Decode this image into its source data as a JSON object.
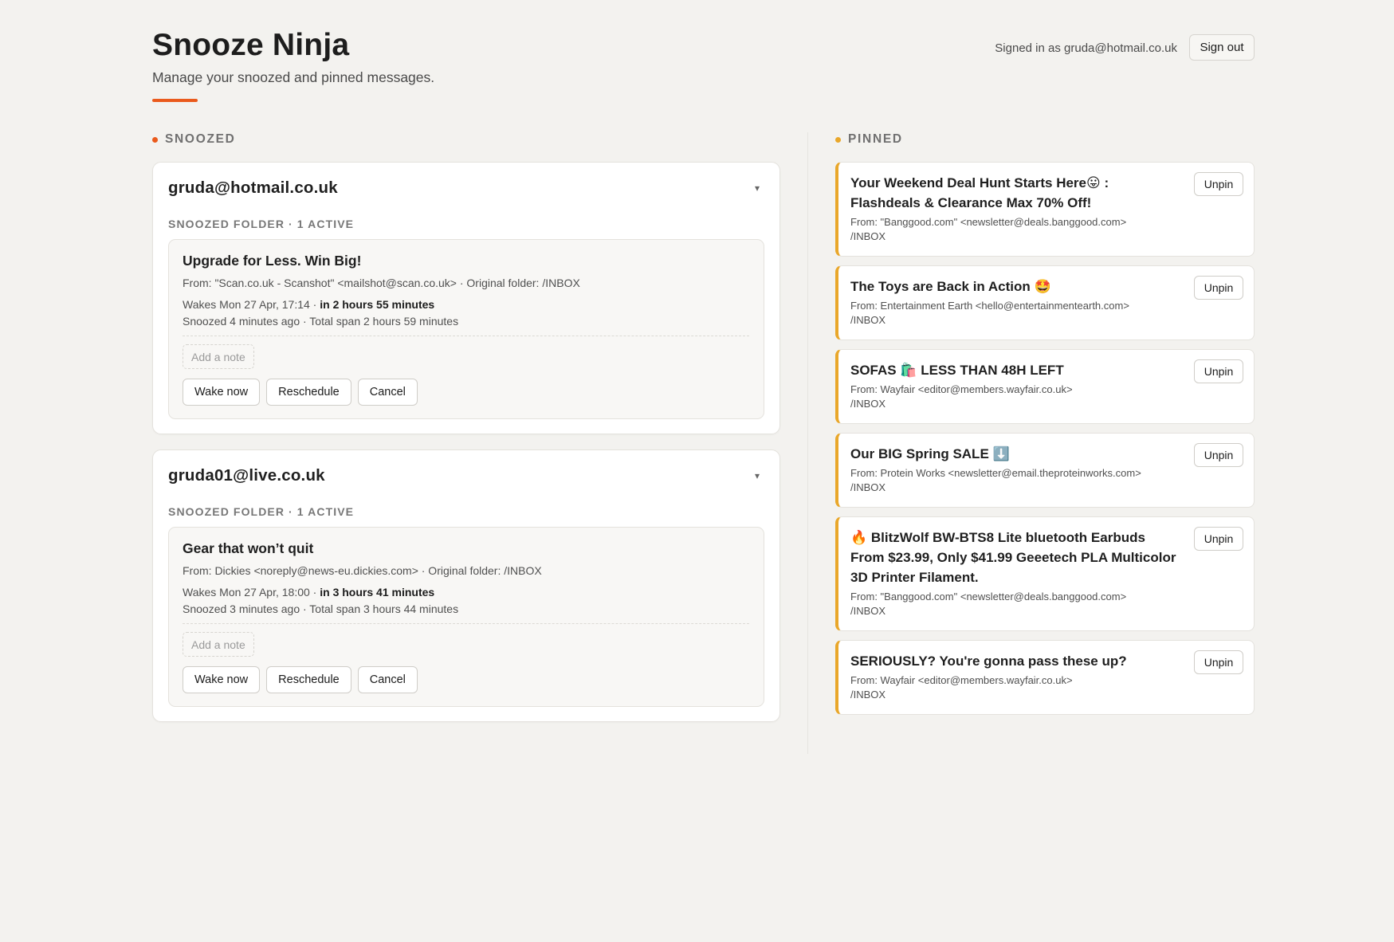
{
  "header": {
    "title": "Snooze Ninja",
    "subtitle": "Manage your snoozed and pinned messages.",
    "signed_in": "Signed in as gruda@hotmail.co.uk",
    "sign_out_label": "Sign out",
    "accent_color": "#ea5a1c"
  },
  "snoozed": {
    "heading": "SNOOZED",
    "dot_color": "#ea5a1c",
    "accounts": [
      {
        "email": "gruda@hotmail.co.uk",
        "caret": "▾",
        "folder_label": "SNOOZED FOLDER · 1 ACTIVE",
        "item": {
          "subject": "Upgrade for Less. Win Big!",
          "from": "From: \"Scan.co.uk - Scanshot\" <mailshot@scan.co.uk> · Original folder: /INBOX",
          "wakes_prefix": "Wakes Mon 27 Apr, 17:14 · ",
          "wakes_in": "in 2 hours 55 minutes",
          "span": "Snoozed 4 minutes ago · Total span 2 hours 59 minutes",
          "note_placeholder": "Add a note",
          "wake_label": "Wake now",
          "reschedule_label": "Reschedule",
          "cancel_label": "Cancel"
        }
      },
      {
        "email": "gruda01@live.co.uk",
        "caret": "▾",
        "folder_label": "SNOOZED FOLDER · 1 ACTIVE",
        "item": {
          "subject": "Gear that won’t quit",
          "from": "From: Dickies <noreply@news-eu.dickies.com> · Original folder: /INBOX",
          "wakes_prefix": "Wakes Mon 27 Apr, 18:00 · ",
          "wakes_in": "in 3 hours 41 minutes",
          "span": "Snoozed 3 minutes ago · Total span 3 hours 44 minutes",
          "note_placeholder": "Add a note",
          "wake_label": "Wake now",
          "reschedule_label": "Reschedule",
          "cancel_label": "Cancel"
        }
      }
    ]
  },
  "pinned": {
    "heading": "PINNED",
    "dot_color": "#e9a72a",
    "unpin_label": "Unpin",
    "items": [
      {
        "subject": "Your Weekend Deal Hunt Starts Here😛 : Flashdeals & Clearance Max 70% Off!",
        "from": "From: \"Banggood.com\" <newsletter@deals.banggood.com>",
        "folder": "/INBOX"
      },
      {
        "subject": "The Toys are Back in Action 🤩",
        "from": "From: Entertainment Earth <hello@entertainmentearth.com>",
        "folder": "/INBOX"
      },
      {
        "subject": "SOFAS 🛍️ LESS THAN 48H LEFT",
        "from": "From: Wayfair <editor@members.wayfair.co.uk>",
        "folder": "/INBOX"
      },
      {
        "subject": "Our BIG Spring SALE ⬇️",
        "from": "From: Protein Works <newsletter@email.theproteinworks.com>",
        "folder": "/INBOX"
      },
      {
        "subject": "🔥 BlitzWolf BW-BTS8 Lite bluetooth Earbuds From $23.99, Only $41.99 Geeetech PLA Multicolor 3D Printer Filament.",
        "from": "From: \"Banggood.com\" <newsletter@deals.banggood.com>",
        "folder": "/INBOX"
      },
      {
        "subject": "SERIOUSLY? You're gonna pass these up?",
        "from": "From: Wayfair <editor@members.wayfair.co.uk>",
        "folder": "/INBOX"
      }
    ]
  }
}
